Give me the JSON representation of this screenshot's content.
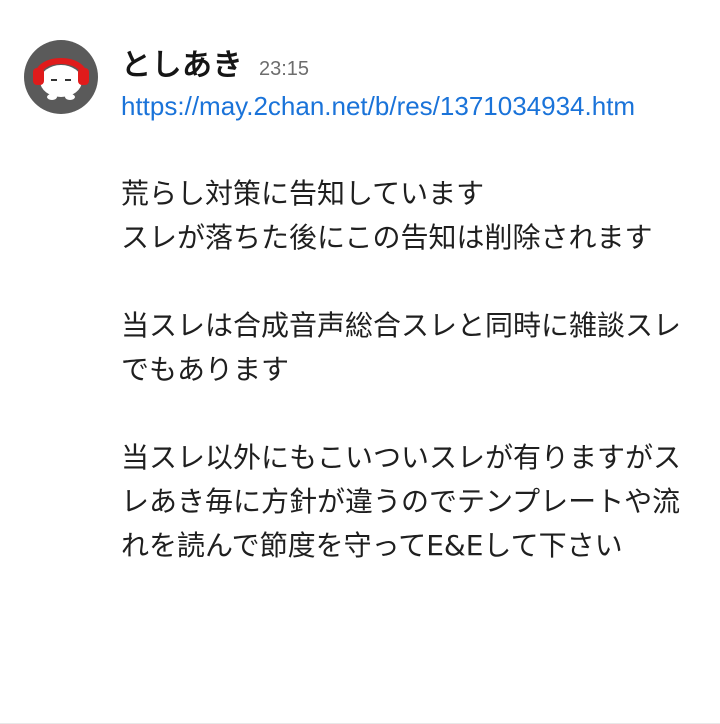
{
  "message": {
    "author": {
      "name": "としあき",
      "avatar_icon": "headphones-character-avatar-icon"
    },
    "timestamp": "23:15",
    "link": "https://may.2chan.net/b/res/1371034934.htm",
    "paragraphs": [
      "荒らし対策に告知しています\nスレが落ちた後にこの告知は削除されます",
      "当スレは合成音声総合スレと同時に雑談スレでもあります",
      "当スレ以外にもこいついスレが有りますがスレあき毎に方針が違うのでテンプレートや流れを読んで節度を守ってE&Eして下さい"
    ]
  },
  "colors": {
    "link": "#1a73d9",
    "avatar_bg": "#5a5a5a",
    "headphones": "#e01b1b",
    "text": "#1f1f1f",
    "timestamp": "#6d6d6d"
  }
}
